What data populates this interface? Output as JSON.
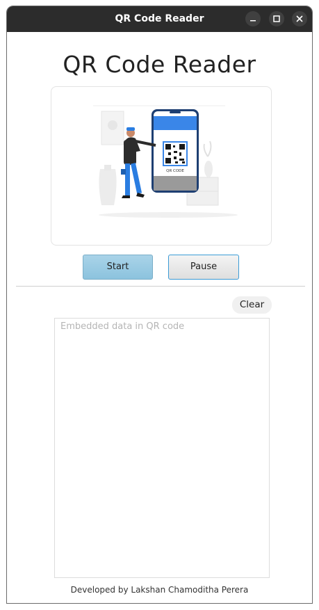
{
  "window": {
    "title": "QR Code Reader",
    "controls": {
      "minimize_icon": "minimize-icon",
      "maximize_icon": "maximize-icon",
      "close_icon": "close-icon"
    }
  },
  "app": {
    "heading": "QR Code Reader",
    "illustration": {
      "phone_label": "QR CODE"
    },
    "start_label": "Start",
    "pause_label": "Pause",
    "clear_label": "Clear",
    "output_placeholder": "Embedded data in QR code",
    "footer": "Developed by Lakshan Chamoditha Perera"
  },
  "colors": {
    "titlebar": "#2c2c2c",
    "start_button": "#9bcbe3",
    "accent_blue": "#3a86e8",
    "person_pants": "#2a7de1"
  }
}
